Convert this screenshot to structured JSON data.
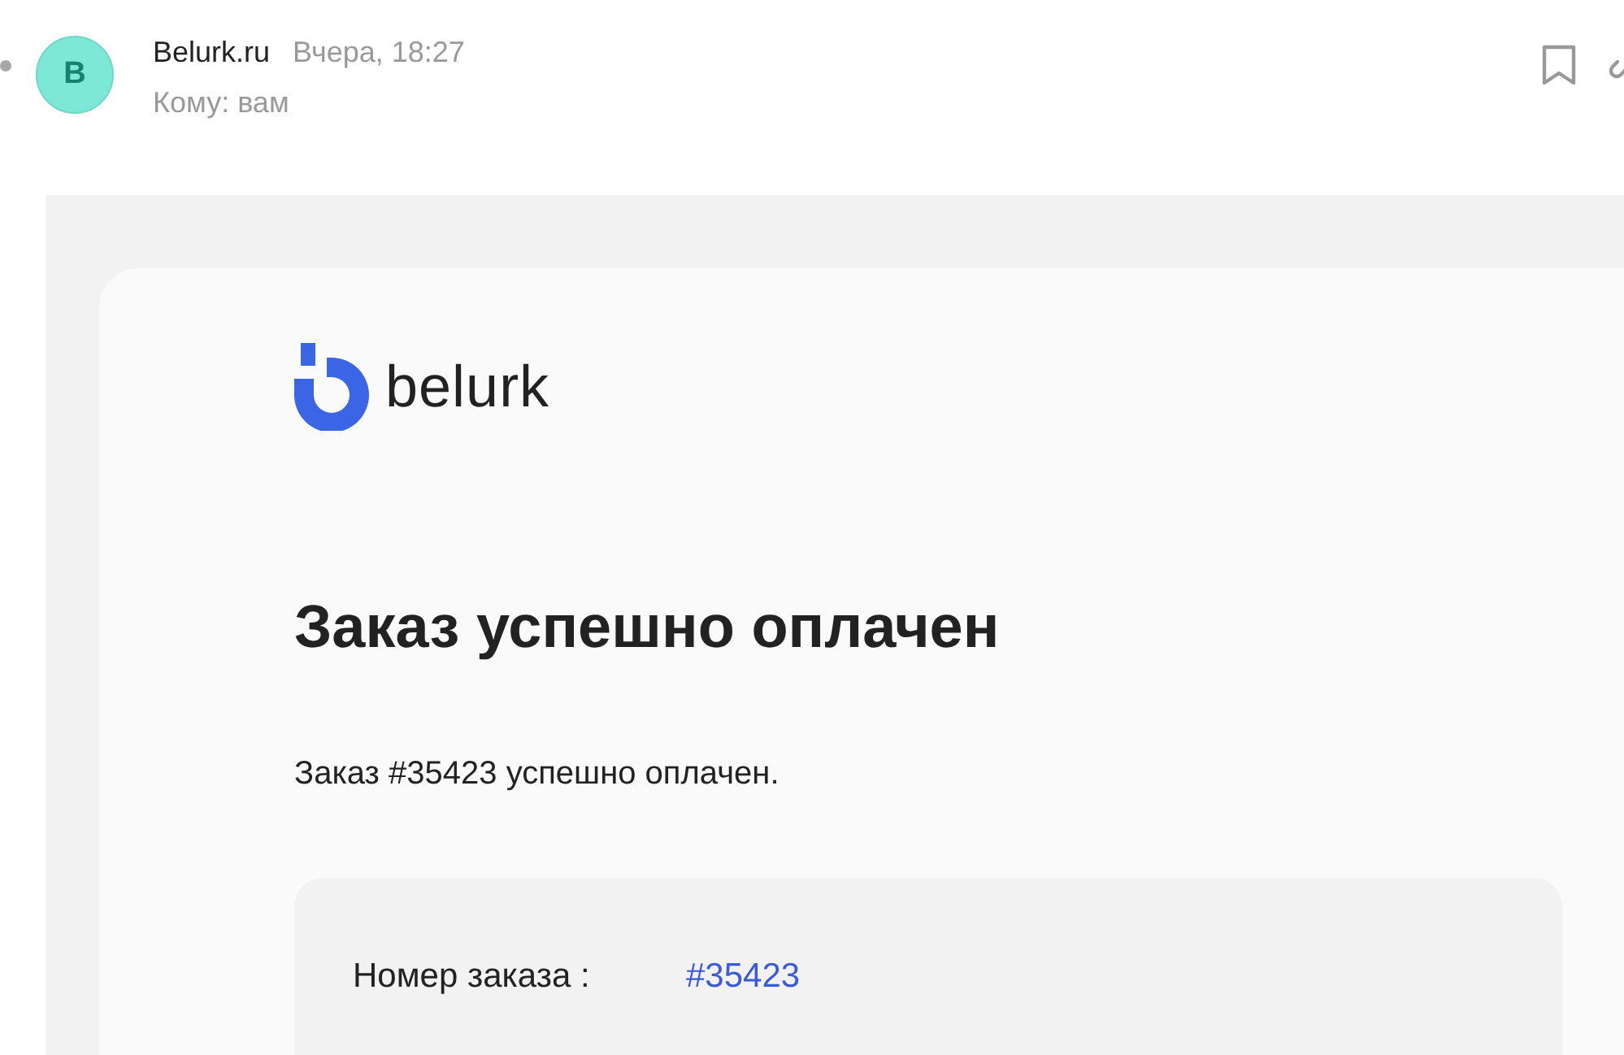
{
  "sender": {
    "avatar_letter": "B",
    "name": "Belurk.ru",
    "time": "Вчера, 18:27",
    "recipient": "Кому: вам",
    "unread": true
  },
  "email": {
    "logo_text": "belurk",
    "title": "Заказ успешно оплачен",
    "message": "Заказ #35423 успешно оплачен.",
    "details": [
      {
        "label": "Номер заказа :",
        "value": "#35423"
      }
    ]
  }
}
